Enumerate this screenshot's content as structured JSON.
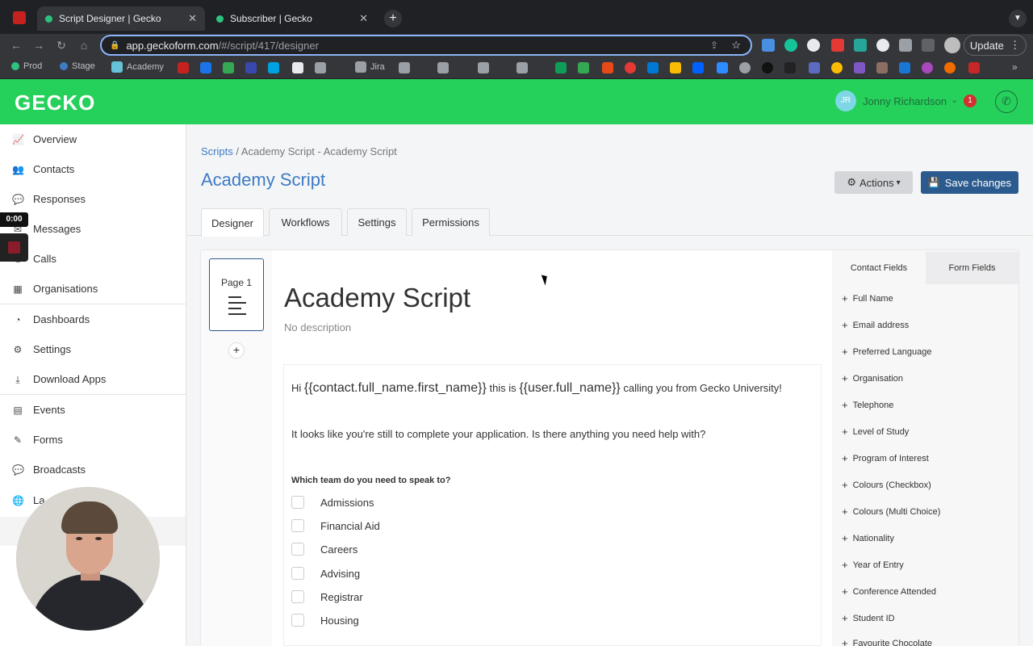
{
  "browser": {
    "tabs": [
      {
        "title": "Script Designer | Gecko",
        "active": true
      },
      {
        "title": "Subscriber | Gecko",
        "active": false
      }
    ],
    "url_host": "app.geckoform.com",
    "url_path": "/#/script/417/designer",
    "update_label": "Update",
    "bookmarks": [
      {
        "label": "Prod",
        "color": "#2ec27e"
      },
      {
        "label": "Stage",
        "color": "#3d7bc4"
      },
      {
        "label": "Academy",
        "color": "#66c2d6"
      },
      {
        "label": "Jira",
        "color": "#9aa0a6"
      }
    ]
  },
  "app": {
    "logo": "GECKO",
    "user": {
      "initials": "JR",
      "name": "Jonny Richardson",
      "notifications": "1"
    }
  },
  "recorder": {
    "time": "0:00"
  },
  "sidebar": {
    "items": [
      {
        "label": "Overview",
        "icon": "chart-icon"
      },
      {
        "label": "Contacts",
        "icon": "users-icon"
      },
      {
        "label": "Responses",
        "icon": "chat-icon"
      },
      {
        "label": "Messages",
        "icon": "message-icon"
      },
      {
        "label": "Calls",
        "icon": "phone-icon"
      },
      {
        "label": "Organisations",
        "icon": "building-icon"
      },
      {
        "label": "Dashboards",
        "icon": "dashboard-icon"
      },
      {
        "label": "Settings",
        "icon": "gear-icon"
      },
      {
        "label": "Download Apps",
        "icon": "download-icon"
      },
      {
        "label": "Events",
        "icon": "calendar-icon"
      },
      {
        "label": "Forms",
        "icon": "form-icon"
      },
      {
        "label": "Broadcasts",
        "icon": "broadcast-icon"
      },
      {
        "label": "La",
        "icon": "globe-icon"
      }
    ]
  },
  "main": {
    "breadcrumb": {
      "root": "Scripts",
      "separator": "/",
      "current": "Academy Script - Academy Script"
    },
    "title": "Academy Script",
    "actions_label": "Actions",
    "save_label": "Save changes",
    "tabs": [
      "Designer",
      "Workflows",
      "Settings",
      "Permissions"
    ],
    "active_tab": "Designer"
  },
  "designer": {
    "page_label": "Page 1",
    "add_page": "+",
    "script_title": "Academy Script",
    "description": "No description",
    "greeting": {
      "hi": "Hi",
      "var1": "{{contact.full_name.first_name}}",
      "mid": "this is",
      "var2": "{{user.full_name}}",
      "tail": "calling you from Gecko University!"
    },
    "line2": "It looks like you're still to complete your application. Is there anything you need help with?",
    "question": "Which team do you need to speak to?",
    "options": [
      "Admissions",
      "Financial Aid",
      "Careers",
      "Advising",
      "Registrar",
      "Housing"
    ]
  },
  "fields_panel": {
    "tabs": [
      "Contact Fields",
      "Form Fields"
    ],
    "active_tab": "Contact Fields",
    "fields": [
      "Full Name",
      "Email address",
      "Preferred Language",
      "Organisation",
      "Telephone",
      "Level of Study",
      "Program of Interest",
      "Colours (Checkbox)",
      "Colours (Multi Choice)",
      "Nationality",
      "Year of Entry",
      "Conference Attended",
      "Student ID",
      "Favourite Chocolate"
    ]
  },
  "colors": {
    "brand_green": "#25d05b",
    "primary_blue": "#2a5a8e",
    "link_blue": "#3d7bc4"
  }
}
